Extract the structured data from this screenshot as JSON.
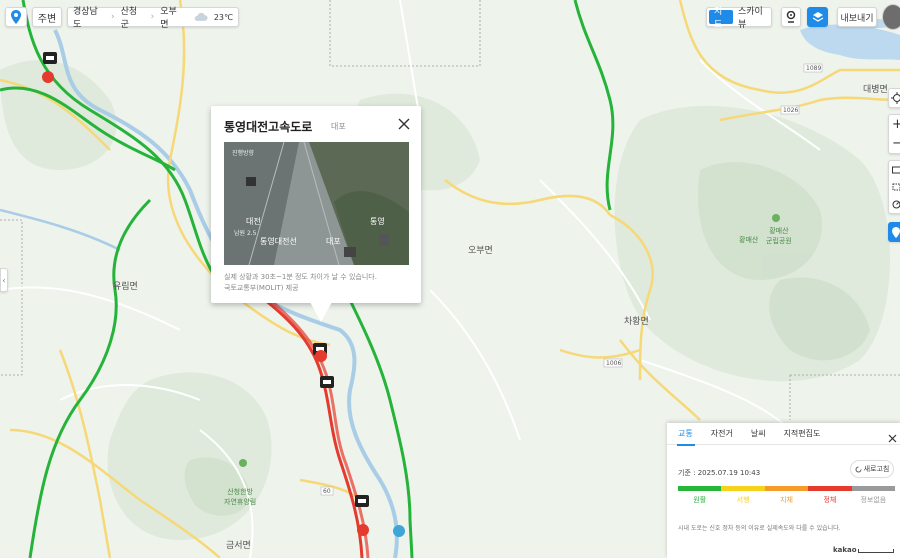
{
  "top_bar": {
    "nearby_label": "주변",
    "breadcrumb": [
      "경상남도",
      "산청군",
      "오부면"
    ],
    "weather": {
      "icon": "cloud-icon",
      "temp": "23℃"
    }
  },
  "map_type": {
    "map_label": "지도",
    "sky_label": "스카이뷰",
    "active": "지도"
  },
  "export_label": "내보내기",
  "place_labels": {
    "obu": "오부면",
    "yurim": "유림면",
    "chahwang": "차황면",
    "geumseo": "금서면",
    "daebyeong": "대병면",
    "hwangmae_peak": "황매산",
    "hwangmae_park": "황매산\n군립공원",
    "sancheong_hall": "산청한방\n자연휴양림"
  },
  "road_numbers": [
    "1089",
    "1026",
    "1006",
    "60"
  ],
  "cctv_popup": {
    "title": "통영대전고속도로",
    "subtitle": "대포",
    "video_overlay": {
      "left_top": "진행방향",
      "left_mid": "대전",
      "left_dist": "남원 2.5",
      "center": "통영대전선",
      "center_right": "대포",
      "right": "통영"
    },
    "note": "실제 상황과 30초~1분 정도 차이가 날 수 있습니다.",
    "provider": "국토교통부(MOLIT) 제공"
  },
  "traffic_panel": {
    "tabs": [
      "교통",
      "자전거",
      "날씨",
      "지적편집도"
    ],
    "active_tab": "교통",
    "timestamp": "기준 : 2025.07.19 10:43",
    "refresh_label": "새로고침",
    "legend": [
      {
        "label": "원활",
        "color": "#27b53a"
      },
      {
        "label": "서행",
        "color": "#f5d21d"
      },
      {
        "label": "지체",
        "color": "#f39b2b"
      },
      {
        "label": "정체",
        "color": "#e53a2e"
      },
      {
        "label": "정보없음",
        "color": "#9a9a9a"
      }
    ],
    "footnote": "시내 도로는 신호 정차 등의 이유로 실제속도와 다를 수 있습니다."
  },
  "scale_label": "kakao"
}
